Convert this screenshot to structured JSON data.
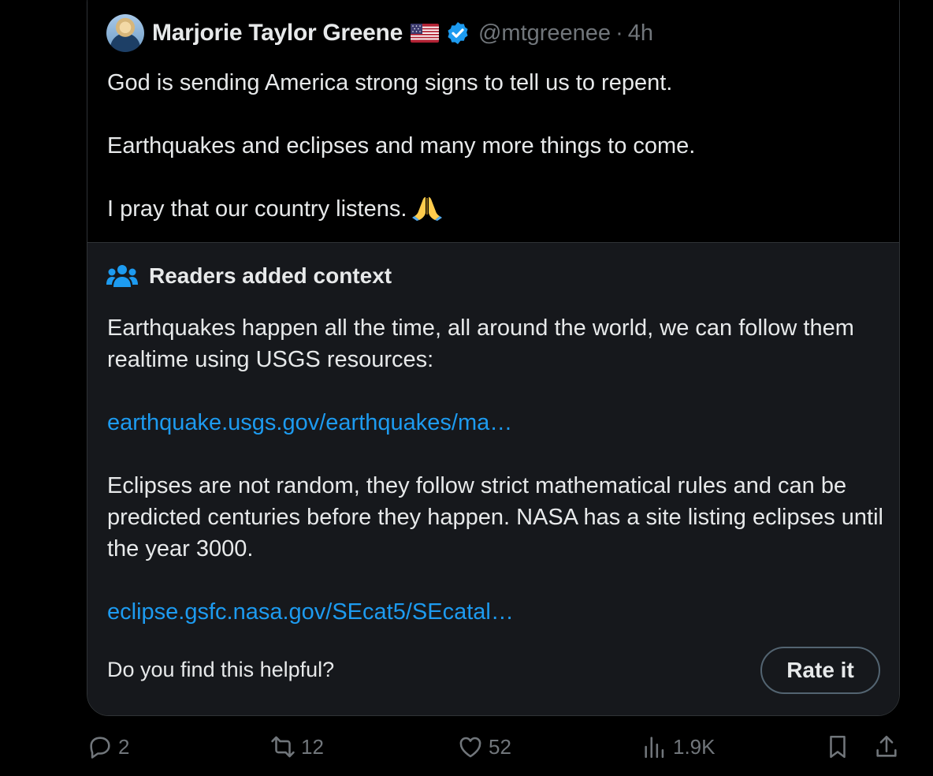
{
  "tweet": {
    "author": {
      "display_name": "Marjorie Taylor Greene",
      "handle": "@mtgreenee",
      "separator": "·",
      "time": "4h"
    },
    "paragraphs": [
      "God is sending America strong signs to tell us to repent.",
      "Earthquakes and eclipses and many more things to come.",
      "I pray that our country listens."
    ]
  },
  "context_note": {
    "title": "Readers added context",
    "paragraph1": "Earthquakes happen all the time, all around the world, we can follow them realtime using USGS resources:",
    "link1": "earthquake.usgs.gov/earthquakes/ma…",
    "paragraph2": "Eclipses are not random, they follow strict mathematical rules and can be predicted centuries before they happen. NASA has a site listing eclipses until the year 3000.",
    "link2": "eclipse.gsfc.nasa.gov/SEcat5/SEcatal…",
    "helpful_prompt": "Do you find this helpful?",
    "rate_label": "Rate it"
  },
  "actions": {
    "replies": "2",
    "reposts": "12",
    "likes": "52",
    "views": "1.9K"
  },
  "colors": {
    "link": "#1d9bf0",
    "verified": "#1d9bf0",
    "muted": "#71767b",
    "note_bg": "#16181c"
  }
}
